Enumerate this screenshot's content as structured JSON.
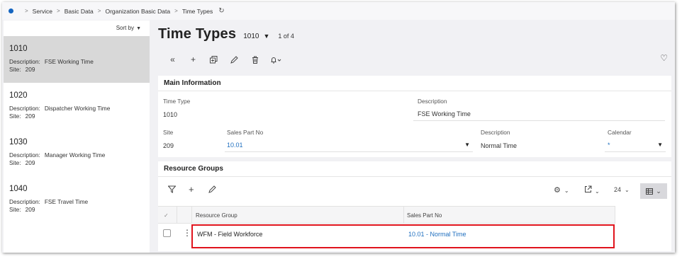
{
  "breadcrumb": [
    "Service",
    "Basic Data",
    "Organization Basic Data",
    "Time Types"
  ],
  "sort_label": "Sort by",
  "records": [
    {
      "code": "1010",
      "desc_label": "Description:",
      "desc": "FSE Working Time",
      "site_label": "Site:",
      "site": "209"
    },
    {
      "code": "1020",
      "desc_label": "Description:",
      "desc": "Dispatcher Working Time",
      "site_label": "Site:",
      "site": "209"
    },
    {
      "code": "1030",
      "desc_label": "Description:",
      "desc": "Manager Working Time",
      "site_label": "Site:",
      "site": "209"
    },
    {
      "code": "1040",
      "desc_label": "Description:",
      "desc": "FSE Travel Time",
      "site_label": "Site:",
      "site": "209"
    }
  ],
  "header": {
    "title": "Time Types",
    "key": "1010",
    "count": "1 of 4"
  },
  "toolbar_icons": [
    "collapse-left-icon",
    "add-icon",
    "duplicate-icon",
    "edit-icon",
    "delete-icon",
    "notification-bell-icon",
    "favorite-heart-icon"
  ],
  "main_info": {
    "heading": "Main Information",
    "time_type_label": "Time Type",
    "time_type": "1010",
    "description_label": "Description",
    "description": "FSE Working Time",
    "site_label": "Site",
    "site": "209",
    "sales_part_label": "Sales Part No",
    "sales_part": "10.01",
    "sp_description_label": "Description",
    "sp_description": "Normal Time",
    "calendar_label": "Calendar",
    "calendar": "*"
  },
  "resource_groups": {
    "heading": "Resource Groups",
    "page_size": "24",
    "columns": [
      "Resource Group",
      "Sales Part No"
    ],
    "rows": [
      {
        "resource_group": "WFM - Field Workforce",
        "sales_part": "10.01 - Normal Time"
      }
    ]
  },
  "colors": {
    "accent": "#1f6fbf",
    "highlight": "#e0141d",
    "selected": "#d8d8d8"
  }
}
